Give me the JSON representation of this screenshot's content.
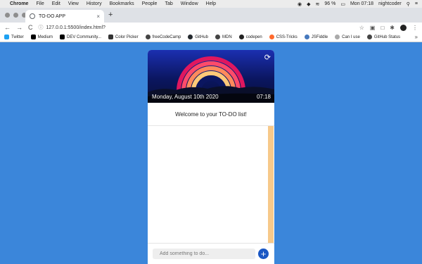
{
  "menubar": {
    "apple_icon": "",
    "items": [
      "Chrome",
      "File",
      "Edit",
      "View",
      "History",
      "Bookmarks",
      "People",
      "Tab",
      "Window",
      "Help"
    ],
    "battery": "96 %",
    "clock": "Mon 07:18",
    "user": "nightcoder"
  },
  "browser": {
    "tab_title": "TO-DO APP",
    "close_glyph": "×",
    "newtab_glyph": "+",
    "url": "127.0.0.1:5500/index.html?",
    "back_glyph": "←",
    "forward_glyph": "→",
    "reload_glyph": "C",
    "info_glyph": "ⓘ",
    "star_glyph": "☆"
  },
  "bookmarks": [
    {
      "label": "Twitter",
      "color": "#1da1f2"
    },
    {
      "label": "Medium",
      "color": "#000000"
    },
    {
      "label": "DEV Community...",
      "color": "#000000"
    },
    {
      "label": "Color Picker",
      "color": "#333333"
    },
    {
      "label": "freeCodeCamp",
      "color": "#444444"
    },
    {
      "label": "GitHub",
      "color": "#24292e"
    },
    {
      "label": "MDN",
      "color": "#444444"
    },
    {
      "label": "codepen",
      "color": "#222222"
    },
    {
      "label": "CSS-Tricks",
      "color": "#ff6a2d"
    },
    {
      "label": "JSFiddle",
      "color": "#4679bd"
    },
    {
      "label": "Can I use",
      "color": "#aaaaaa"
    },
    {
      "label": "GitHub Status",
      "color": "#444444"
    }
  ],
  "bookmarks_more": "»",
  "app": {
    "date": "Monday, August 10th 2020",
    "time": "07:18",
    "welcome": "Welcome to your TO-DO list!",
    "input_placeholder": "Add something to do...",
    "add_glyph": "+",
    "refresh_glyph": "⟳",
    "accent": "#1a57c4",
    "background": "#3b86da",
    "scrollbar_color": "#f7c98a"
  }
}
